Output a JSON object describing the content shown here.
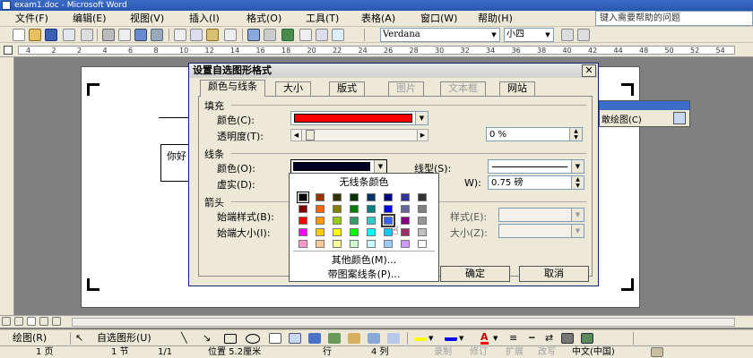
{
  "window": {
    "title": "exam1.doc - Microsoft Word"
  },
  "menubar": {
    "items": [
      "文件(F)",
      "编辑(E)",
      "视图(V)",
      "插入(I)",
      "格式(O)",
      "工具(T)",
      "表格(A)",
      "窗口(W)",
      "帮助(H)"
    ],
    "help_placeholder": "键入需要帮助的问题"
  },
  "toolbar": {
    "font_name": "Verdana",
    "font_size": "小四"
  },
  "ruler": {
    "ticks": [
      "4",
      "2",
      "2",
      "4",
      "6",
      "8",
      "10",
      "12",
      "14",
      "16",
      "18",
      "20",
      "22",
      "24",
      "26",
      "28",
      "30",
      "32",
      "34",
      "36",
      "38",
      "40",
      "42",
      "44",
      "48",
      "50",
      "52",
      "54"
    ]
  },
  "document": {
    "text_box": "你好",
    "float_panel_label": "敢绘图(C)"
  },
  "dialog": {
    "title": "设置自选图形格式",
    "tabs": [
      {
        "label": "颜色与线条",
        "active": true,
        "disabled": false
      },
      {
        "label": "大小",
        "active": false,
        "disabled": false
      },
      {
        "label": "版式",
        "active": false,
        "disabled": false
      },
      {
        "label": "图片",
        "active": false,
        "disabled": true
      },
      {
        "label": "文本框",
        "active": false,
        "disabled": true
      },
      {
        "label": "网站",
        "active": false,
        "disabled": false
      }
    ],
    "fill": {
      "section": "填充",
      "color_label": "颜色(C):",
      "color_value": "#ff0000",
      "transparency_label": "透明度(T):",
      "transparency_value": "0 %"
    },
    "line": {
      "section": "线条",
      "color_label": "颜色(O):",
      "color_value": "#000020",
      "style_label": "线型(S):",
      "dash_label": "虚实(D):",
      "weight_partial_label": "W):",
      "weight_value": "0.75 磅"
    },
    "arrows": {
      "section": "箭头",
      "begin_style_label": "始端样式(B):",
      "begin_size_label": "始端大小(I):",
      "end_style_partial": "样式(E):",
      "end_size_partial": "大小(Z):"
    },
    "ok_label": "确定",
    "cancel_label": "取消"
  },
  "color_popup": {
    "no_line_label": "无线条颜色",
    "more_colors_label": "其他颜色(M)...",
    "patterned_label": "带图案线条(P)...",
    "swatches": [
      [
        "#000000",
        "#993300",
        "#333300",
        "#003300",
        "#003366",
        "#000080",
        "#333399",
        "#333333"
      ],
      [
        "#800000",
        "#ff6600",
        "#808000",
        "#008000",
        "#008080",
        "#0000ff",
        "#666699",
        "#808080"
      ],
      [
        "#ff0000",
        "#ff9900",
        "#99cc00",
        "#339966",
        "#33cccc",
        "#3366ff",
        "#800080",
        "#969696"
      ],
      [
        "#ff00ff",
        "#ffcc00",
        "#ffff00",
        "#00ff00",
        "#00ffff",
        "#00ccff",
        "#993366",
        "#c0c0c0"
      ],
      [
        "#ff99cc",
        "#ffcc99",
        "#ffff99",
        "#ccffcc",
        "#ccffff",
        "#99ccff",
        "#cc99ff",
        "#ffffff"
      ]
    ]
  },
  "drawbar": {
    "draw_label": "绘图(R)",
    "autoshapes_label": "自选图形(U)"
  },
  "statusbar": {
    "page": "1 页",
    "section": "1 节",
    "fraction": "1/1",
    "position": "位置 5.2厘米",
    "line": "行",
    "column": "4 列",
    "rec": "录制",
    "trk": "修订",
    "ext": "扩展",
    "ovr": "改写",
    "language": "中文(中国)"
  }
}
